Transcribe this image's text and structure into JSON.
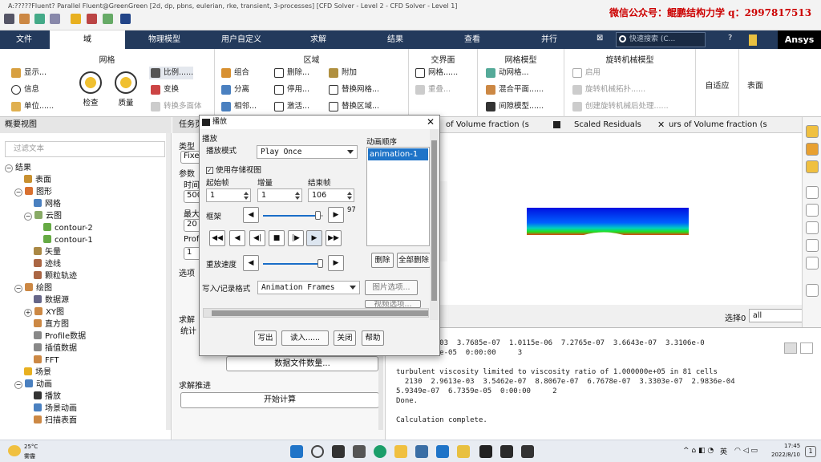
{
  "app": {
    "title": "A:?????Fluent? Parallel Fluent@GreenGreen  [2d, dp, pbns, eulerian, rke, transient, 3-processes] [CFD Solver - Level 2 - CFD Solver - Level 1]",
    "watermark": "微信公众号：鲲鹏结构力学  q：2997817513"
  },
  "menu": {
    "items": [
      "文件",
      "域",
      "物理模型",
      "用户自定义",
      "求解",
      "结果",
      "查看",
      "并行"
    ],
    "search_placeholder": "快速搜索 (C...",
    "brand": "Ansys",
    "colors": {
      "bar": "#233a5c",
      "accent": "#1f74c8"
    }
  },
  "ribbon": {
    "mesh": {
      "title": "网格",
      "display": "显示...",
      "info": "信息",
      "units": "单位......",
      "check": "检查",
      "quality": "质量",
      "scale": "比例......",
      "transform": "变换",
      "polyhedra": "转换多面体"
    },
    "zone": {
      "title": "区域",
      "combine": "组合",
      "separate": "分离",
      "adjacency": "相邻...",
      "delete": "删除...",
      "deactivate": "停用...",
      "activate": "激活...",
      "append": "附加",
      "replace_mesh": "替换网格...",
      "replace_zone": "替换区域..."
    },
    "interface": {
      "title": "交界面",
      "mesh": "网格......",
      "overset": "重叠..."
    },
    "mesh_models": {
      "title": "网格模型",
      "dynamic": "动网格...",
      "mixing": "混合平面......",
      "gap": "间隙模型......"
    },
    "turbo": {
      "title": "旋转机械模型",
      "enable": "启用",
      "topology": "旋转机械拓扑......",
      "post": "创建旋转机械后处理......"
    },
    "adapt": "自适应",
    "surface": "表面"
  },
  "tree": {
    "title": "概要视图",
    "filter_placeholder": "过滤文本",
    "nodes": [
      "结果",
      "表面",
      "图形",
      "网格",
      "云图",
      "contour-2",
      "contour-1",
      "矢量",
      "迹线",
      "颗粒轨迹",
      "绘图",
      "数据源",
      "XY图",
      "直方图",
      "Profile数据",
      "插值数据",
      "FFT",
      "场景",
      "动画",
      "播放",
      "场景动画",
      "扫描表面"
    ]
  },
  "task": {
    "title": "任务页",
    "type": "类型",
    "fixed": "Fixe",
    "params": "参数",
    "time": "时间",
    "v500": "500",
    "max": "最大",
    "v20": "20",
    "profile": "Profi",
    "v1": "1",
    "options": "选项",
    "solve": "求解",
    "stats": "统计",
    "data_btn": "数据文件数量...",
    "advance": "求解推进",
    "start_btn": "开始计算"
  },
  "tabs": {
    "t1": "of Volume fraction (s",
    "t2": "Scaled Residuals",
    "t3": "urs of Volume fraction (s"
  },
  "select": {
    "label": "选择0",
    "value": "all"
  },
  "console": {
    "lines": [
      "  .10458e-03  3.7685e-07  1.0115e-06  7.2765e-07  3.6643e-07  3.3106e-0",
      "07  7.2076e-05  0:00:00     3",
      "",
      "turbulent viscosity limited to viscosity ratio of 1.000000e+05 in 81 cells",
      "  2130  2.9613e-03  3.5462e-07  8.8067e-07  6.7678e-07  3.3303e-07  2.9836e-04",
      "5.9349e-07  6.7359e-05  0:00:00     2",
      "Done.",
      "",
      "Calculation complete."
    ]
  },
  "dialog": {
    "title": "播放",
    "section": "播放",
    "mode_label": "播放模式",
    "mode": "Play Once",
    "use_stored": "使用存储视图",
    "start_label": "起始帧",
    "increment_label": "增量",
    "end_label": "结束帧",
    "start": "1",
    "increment": "1",
    "end": "106",
    "frame_label": "框架",
    "frame_value": "97",
    "frame_progress": 0.91,
    "speed_label": "重放速度",
    "speed_progress": 0.95,
    "sequence_label": "动画顺序",
    "sequence": [
      "animation-1"
    ],
    "delete": "删除",
    "delete_all": "全部删除",
    "write_label": "写入/记录格式",
    "write_format": "Animation Frames",
    "image_options": "图片选项...",
    "video_options": "视频选项...",
    "write_btn": "写出",
    "read_btn": "读入......",
    "close_btn": "关闭",
    "help_btn": "帮助"
  },
  "status": {
    "weather_temp": "25°C",
    "weather": "雾霾",
    "lang": "英",
    "time": "17:45",
    "date": "2022/8/10"
  }
}
